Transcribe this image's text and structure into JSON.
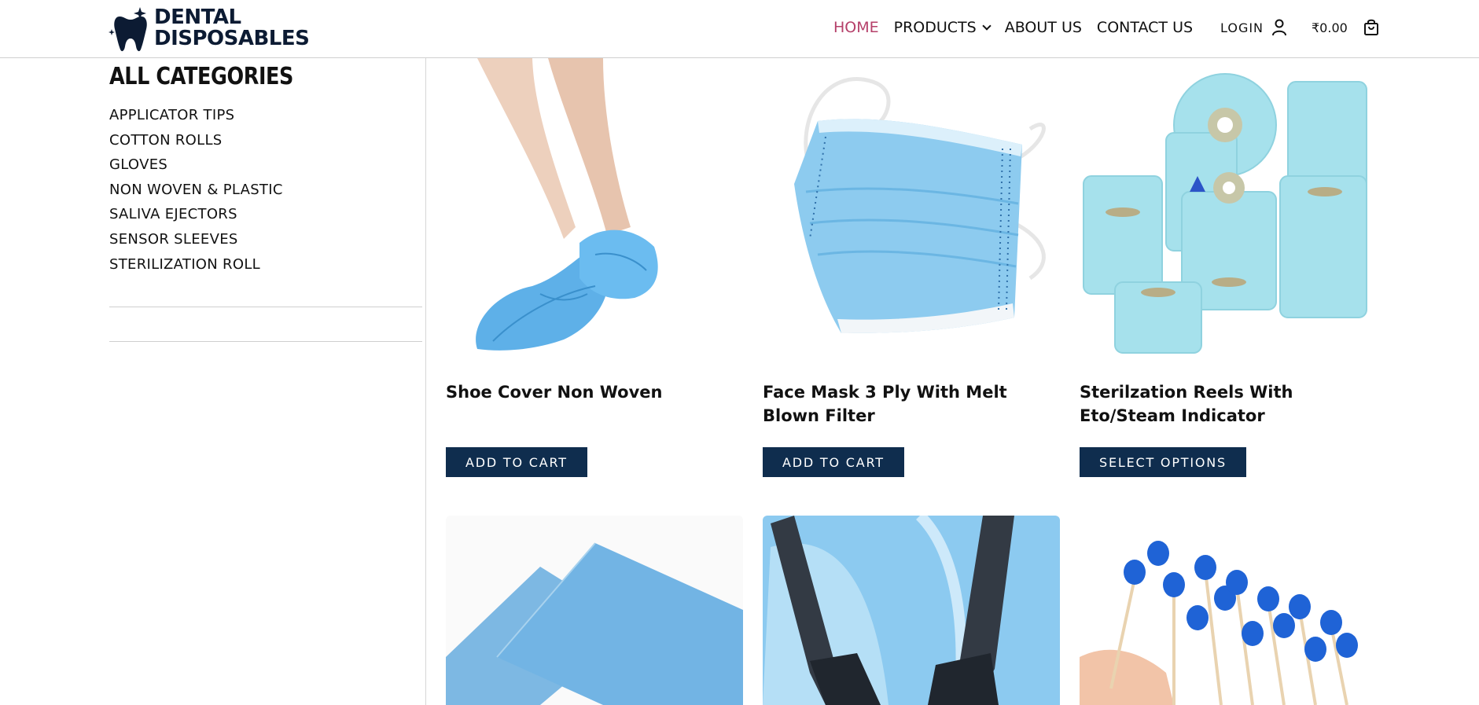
{
  "brand": {
    "line1": "DENTAL",
    "line2": "DISPOSABLES",
    "color": "#0c1b33"
  },
  "nav": {
    "home": "HOME",
    "products": "PRODUCTS",
    "about": "ABOUT US",
    "contact": "CONTACT US",
    "login": "LOGIN",
    "cart_total": "₹0.00",
    "active_color": "#b5406a"
  },
  "sidebar": {
    "title": "ALL CATEGORIES",
    "categories": [
      "APPLICATOR TIPS",
      "COTTON ROLLS",
      "GLOVES",
      "NON WOVEN & PLASTIC",
      "SALIVA EJECTORS",
      "SENSOR SLEEVES",
      "STERILIZATION ROLL"
    ]
  },
  "products": [
    {
      "name": "Shoe Cover Non Woven",
      "button": "ADD TO CART"
    },
    {
      "name": "Face Mask 3 Ply With Melt Blown Filter",
      "button": "ADD TO CART"
    },
    {
      "name": "Sterilzation Reels With Eto/Steam Indicator",
      "button": "SELECT OPTIONS"
    }
  ],
  "colors": {
    "button_bg": "#0f2d4e",
    "product_blue": "#7fc3ea"
  }
}
